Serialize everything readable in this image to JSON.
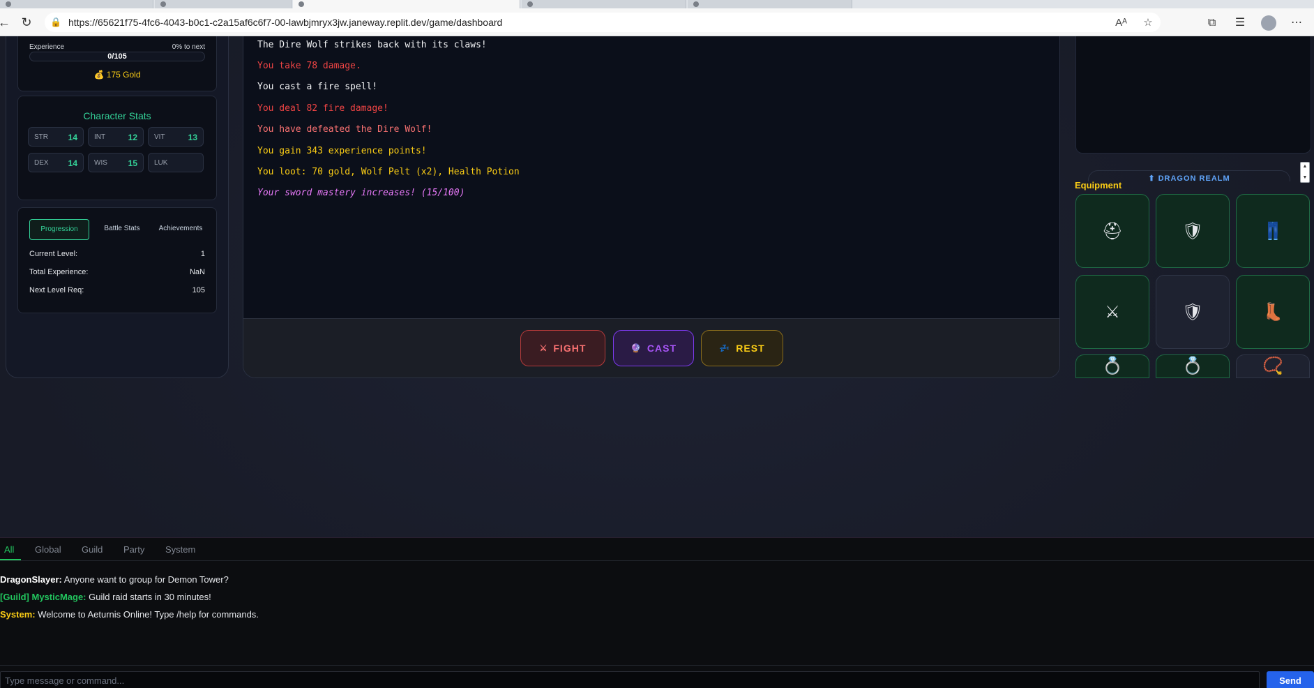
{
  "browser": {
    "url": "https://65621f75-4fc6-4043-b0c1-c2a15af6c6f7-00-lawbjmryx3jw.janeway.replit.dev/game/dashboard"
  },
  "character": {
    "experience_label": "Experience",
    "experience_next": "0% to next",
    "experience_value": "0/105",
    "experience_progress": 0,
    "gold_icon": "💰",
    "gold": "175 Gold"
  },
  "stats": {
    "title": "Character Stats",
    "items": [
      {
        "key": "STR",
        "value": "14"
      },
      {
        "key": "INT",
        "value": "12"
      },
      {
        "key": "VIT",
        "value": "13"
      },
      {
        "key": "DEX",
        "value": "14"
      },
      {
        "key": "WIS",
        "value": "15"
      },
      {
        "key": "LUK",
        "value": ""
      }
    ]
  },
  "progress_panel": {
    "tabs": [
      "Progression",
      "Battle Stats",
      "Achievements"
    ],
    "rows": [
      {
        "label": "Current Level:",
        "value": "1"
      },
      {
        "label": "Total Experience:",
        "value": "NaN"
      },
      {
        "label": "Next Level Req:",
        "value": "105"
      }
    ]
  },
  "combat_log": [
    {
      "text": "The Dire Wolf strikes back with its claws!",
      "color": "#f3f4f6"
    },
    {
      "text": "You take 78 damage.",
      "color": "#ef4444"
    },
    {
      "text": "You cast a fire spell!",
      "color": "#f3f4f6"
    },
    {
      "text": "You deal 82 fire damage!",
      "color": "#ef4444"
    },
    {
      "text": "You have defeated the Dire Wolf!",
      "color": "#f87171"
    },
    {
      "text": "You gain 343 experience points!",
      "color": "#facc15"
    },
    {
      "text": "You loot: 70 gold, Wolf Pelt (x2), Health Potion",
      "color": "#facc15"
    },
    {
      "text": "Your sword mastery increases! (15/100)",
      "color": "#e879f9"
    }
  ],
  "actions": {
    "fight": {
      "icon": "⚔",
      "label": "FIGHT",
      "color": "#f87171"
    },
    "cast": {
      "icon": "🔮",
      "label": "CAST",
      "color": "#a855f7"
    },
    "rest": {
      "icon": "💤",
      "label": "REST",
      "color": "#facc15"
    }
  },
  "equipment": {
    "title": "Equipment",
    "partial_button": "⬆ DRAGON REALM",
    "slots": [
      {
        "icon": "⛑",
        "name": "helmet-icon"
      },
      {
        "icon": "🛡",
        "name": "shield-icon"
      },
      {
        "icon": "👖",
        "name": "pants-icon"
      },
      {
        "icon": "⚔",
        "name": "crossed-swords-icon"
      },
      {
        "icon": "🛡",
        "name": "shield-icon"
      },
      {
        "icon": "👢",
        "name": "boots-icon"
      },
      {
        "icon": "💍",
        "name": "ring-icon"
      },
      {
        "icon": "💍",
        "name": "ring-icon"
      },
      {
        "icon": "📿",
        "name": "amulet-icon"
      }
    ]
  },
  "chat": {
    "tabs": [
      "All",
      "Global",
      "Guild",
      "Party",
      "System"
    ],
    "messages": [
      {
        "who": "DragonSlayer:",
        "who_color": "#ffffff",
        "text": " Anyone want to group for Demon Tower?"
      },
      {
        "who": "[Guild] MysticMage:",
        "who_color": "#22c55e",
        "text": " Guild raid starts in 30 minutes!"
      },
      {
        "who": "System:",
        "who_color": "#facc15",
        "text": " Welcome to Aeturnis Online! Type /help for commands."
      }
    ],
    "input_placeholder": "Type message or command...",
    "send_label": "Send"
  }
}
